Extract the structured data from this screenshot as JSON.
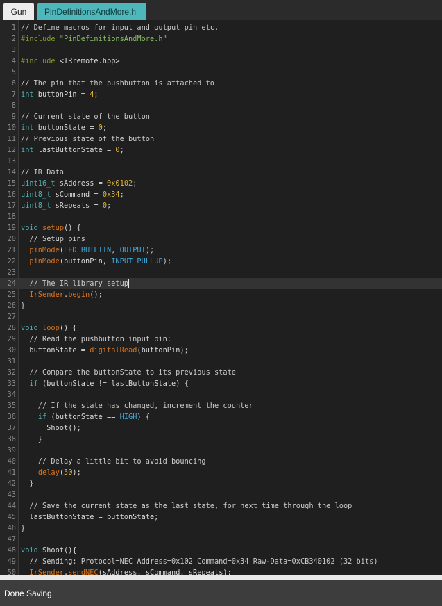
{
  "tabs": [
    {
      "label": "Gun",
      "active": false
    },
    {
      "label": "PinDefinitionsAndMore.h",
      "active": true
    }
  ],
  "editor": {
    "current_line": 24,
    "lines": [
      [
        [
          "c",
          "// Define macros for input and output pin etc."
        ]
      ],
      [
        [
          "pp",
          "#include "
        ],
        [
          "s",
          "\"PinDefinitionsAndMore.h\""
        ]
      ],
      [],
      [
        [
          "pp",
          "#include "
        ],
        [
          "p",
          "<IRremote.hpp>"
        ]
      ],
      [],
      [
        [
          "c",
          "// The pin that the pushbutton is attached to"
        ]
      ],
      [
        [
          "k",
          "int"
        ],
        [
          "p",
          " buttonPin = "
        ],
        [
          "n",
          "4"
        ],
        [
          "p",
          ";"
        ]
      ],
      [],
      [
        [
          "c",
          "// Current state of the button"
        ]
      ],
      [
        [
          "k",
          "int"
        ],
        [
          "p",
          " buttonState = "
        ],
        [
          "n",
          "0"
        ],
        [
          "p",
          ";"
        ]
      ],
      [
        [
          "c",
          "// Previous state of the button"
        ]
      ],
      [
        [
          "k",
          "int"
        ],
        [
          "p",
          " lastButtonState = "
        ],
        [
          "n",
          "0"
        ],
        [
          "p",
          ";"
        ]
      ],
      [],
      [
        [
          "c",
          "// IR Data"
        ]
      ],
      [
        [
          "k",
          "uint16_t"
        ],
        [
          "p",
          " sAddress = "
        ],
        [
          "n",
          "0x0102"
        ],
        [
          "p",
          ";"
        ]
      ],
      [
        [
          "k",
          "uint8_t"
        ],
        [
          "p",
          " sCommand = "
        ],
        [
          "n",
          "0x34"
        ],
        [
          "p",
          ";"
        ]
      ],
      [
        [
          "k",
          "uint8_t"
        ],
        [
          "p",
          " sRepeats = "
        ],
        [
          "n",
          "0"
        ],
        [
          "p",
          ";"
        ]
      ],
      [],
      [
        [
          "k",
          "void"
        ],
        [
          "p",
          " "
        ],
        [
          "f",
          "setup"
        ],
        [
          "p",
          "() {"
        ]
      ],
      [
        [
          "c",
          "  // Setup pins"
        ]
      ],
      [
        [
          "p",
          "  "
        ],
        [
          "f",
          "pinMode"
        ],
        [
          "p",
          "("
        ],
        [
          "ct",
          "LED_BUILTIN"
        ],
        [
          "p",
          ", "
        ],
        [
          "ct",
          "OUTPUT"
        ],
        [
          "p",
          ");"
        ]
      ],
      [
        [
          "p",
          "  "
        ],
        [
          "f",
          "pinMode"
        ],
        [
          "p",
          "(buttonPin, "
        ],
        [
          "ct",
          "INPUT_PULLUP"
        ],
        [
          "p",
          ");"
        ]
      ],
      [],
      [
        [
          "c",
          "  // The IR library setup"
        ],
        [
          "caret",
          ""
        ]
      ],
      [
        [
          "p",
          "  "
        ],
        [
          "f",
          "IrSender"
        ],
        [
          "p",
          "."
        ],
        [
          "f",
          "begin"
        ],
        [
          "p",
          "();"
        ]
      ],
      [
        [
          "p",
          "}"
        ]
      ],
      [],
      [
        [
          "k",
          "void"
        ],
        [
          "p",
          " "
        ],
        [
          "f",
          "loop"
        ],
        [
          "p",
          "() {"
        ]
      ],
      [
        [
          "c",
          "  // Read the pushbutton input pin:"
        ]
      ],
      [
        [
          "p",
          "  buttonState = "
        ],
        [
          "f",
          "digitalRead"
        ],
        [
          "p",
          "(buttonPin);"
        ]
      ],
      [],
      [
        [
          "c",
          "  // Compare the buttonState to its previous state"
        ]
      ],
      [
        [
          "p",
          "  "
        ],
        [
          "k",
          "if"
        ],
        [
          "p",
          " (buttonState != lastButtonState) {"
        ]
      ],
      [],
      [
        [
          "c",
          "    // If the state has changed, increment the counter"
        ]
      ],
      [
        [
          "p",
          "    "
        ],
        [
          "k",
          "if"
        ],
        [
          "p",
          " (buttonState == "
        ],
        [
          "ct",
          "HIGH"
        ],
        [
          "p",
          ") {"
        ]
      ],
      [
        [
          "p",
          "      Shoot();"
        ]
      ],
      [
        [
          "p",
          "    }"
        ]
      ],
      [],
      [
        [
          "c",
          "    // Delay a little bit to avoid bouncing"
        ]
      ],
      [
        [
          "p",
          "    "
        ],
        [
          "f",
          "delay"
        ],
        [
          "p",
          "("
        ],
        [
          "n",
          "50"
        ],
        [
          "p",
          ");"
        ]
      ],
      [
        [
          "p",
          "  }"
        ]
      ],
      [],
      [
        [
          "c",
          "  // Save the current state as the last state, for next time through the loop"
        ]
      ],
      [
        [
          "p",
          "  lastButtonState = buttonState;"
        ]
      ],
      [
        [
          "p",
          "}"
        ]
      ],
      [],
      [
        [
          "k",
          "void"
        ],
        [
          "p",
          " Shoot(){"
        ]
      ],
      [
        [
          "c",
          "  // Sending: Protocol=NEC Address=0x102 Command=0x34 Raw-Data=0xCB340102 (32 bits)"
        ]
      ],
      [
        [
          "p",
          "  "
        ],
        [
          "f",
          "IrSender"
        ],
        [
          "p",
          "."
        ],
        [
          "f",
          "sendNEC"
        ],
        [
          "p",
          "(sAddress, sCommand, sRepeats);"
        ]
      ]
    ]
  },
  "status": {
    "message": "Done Saving."
  },
  "colors": {
    "active_tab": "#4db7bb",
    "comment": "#c9c9c9",
    "keyword": "#4fb1b5",
    "string": "#85bd63",
    "number": "#e0b339",
    "function": "#d7731e",
    "constant": "#3fa7d6",
    "preprocessor": "#7f9a2f"
  }
}
